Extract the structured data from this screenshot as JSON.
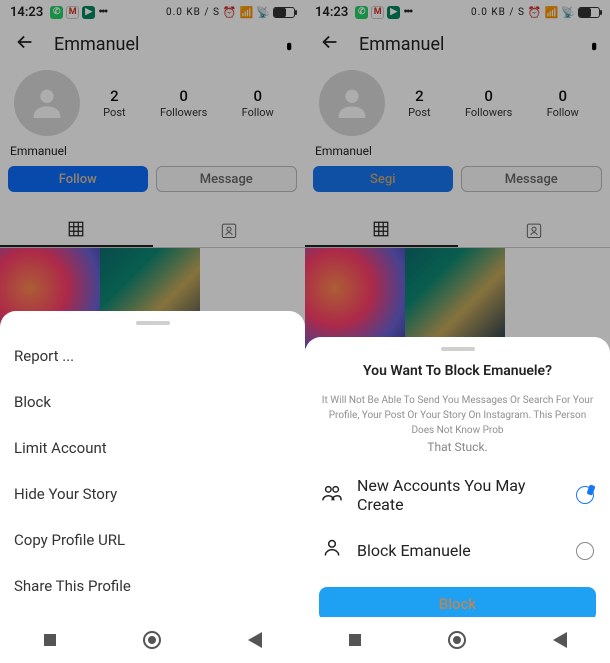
{
  "status": {
    "clock": "14:23",
    "net": "0.0 KB / S",
    "batt": "50"
  },
  "header": {
    "username": "Emmanuel"
  },
  "profile": {
    "displayName": "Emmanuel",
    "stats": {
      "posts": {
        "value": "2",
        "label": "Post"
      },
      "followers": {
        "value": "0",
        "label": "Followers"
      },
      "following": {
        "value": "0",
        "label": "Follow"
      }
    }
  },
  "buttons": {
    "follow": "Follow",
    "follow_short": "Segi",
    "message": "Message"
  },
  "menu": {
    "report": "Report ...",
    "block": "Block",
    "limit": "Limit Account",
    "hide": "Hide Your Story",
    "copy": "Copy Profile URL",
    "share": "Share This Profile"
  },
  "block_dialog": {
    "title": "You Want To Block Emanuele?",
    "desc": "It Will Not Be Able To Send You Messages Or Search For Your Profile, Your Post Or Your Story On Instagram. This Person Does Not Know Prob",
    "desc2": "That Stuck.",
    "opt1": "New Accounts You May Create",
    "opt2": "Block Emanuele",
    "confirm": "Block"
  }
}
